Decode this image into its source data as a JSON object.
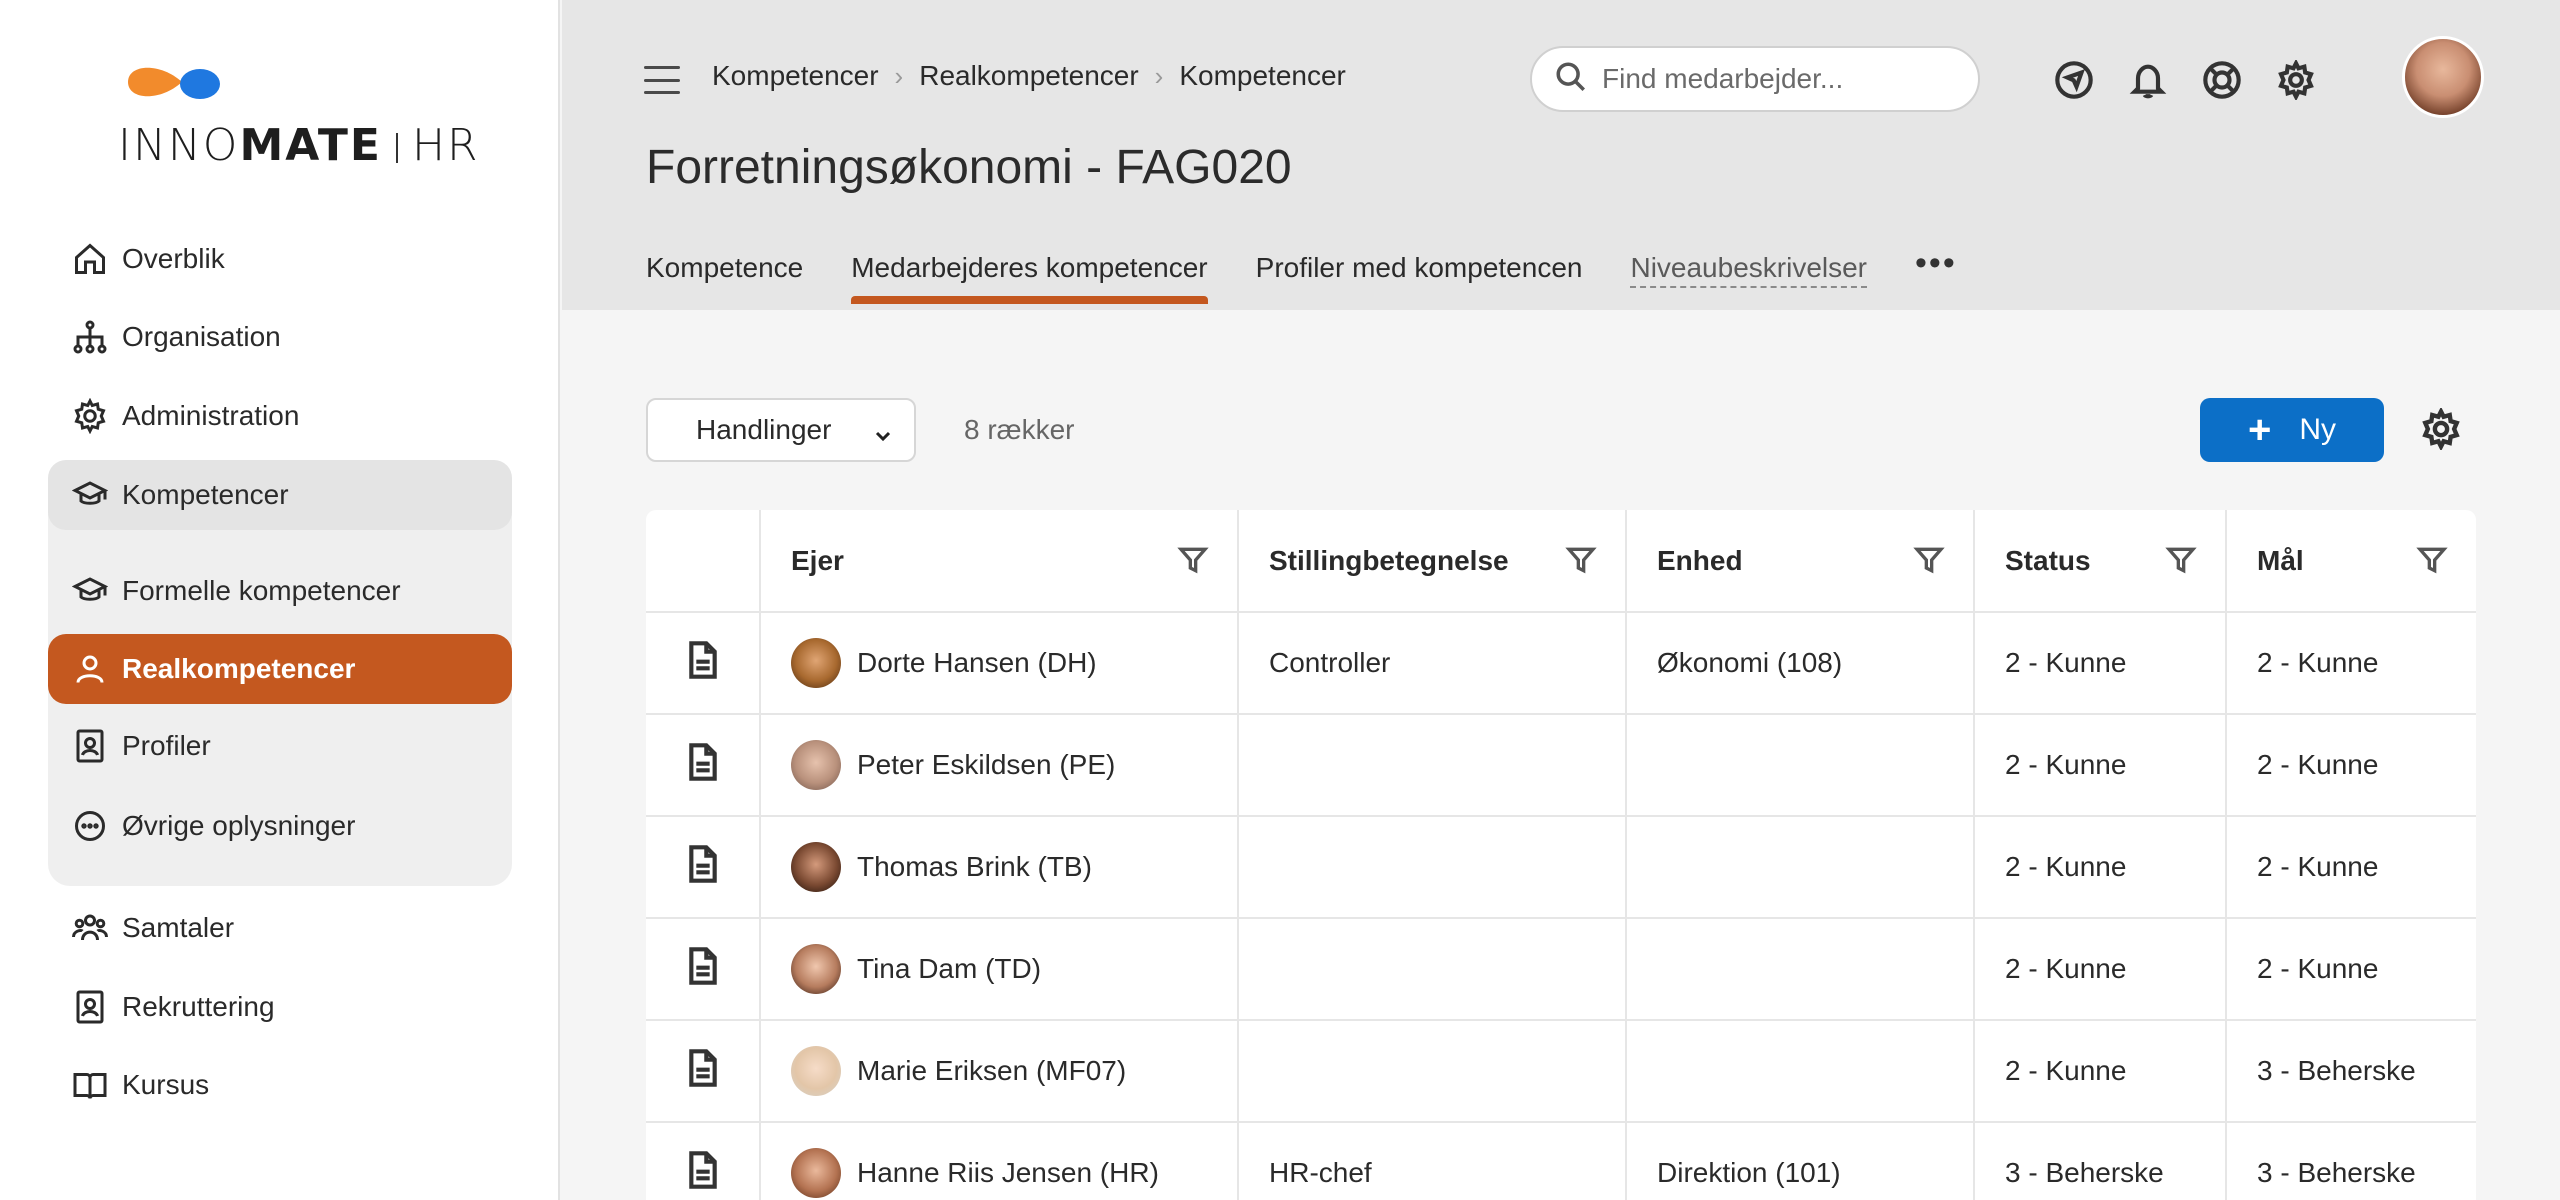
{
  "app": {
    "logo_left": "INNO",
    "logo_mid": "MATE",
    "logo_right": "HR"
  },
  "sidebar": {
    "items": [
      {
        "label": "Overblik",
        "icon": "home-icon"
      },
      {
        "label": "Organisation",
        "icon": "org-chart-icon"
      },
      {
        "label": "Administration",
        "icon": "gear-icon"
      },
      {
        "label": "Kompetencer",
        "icon": "graduation-cap-icon"
      },
      {
        "label": "Formelle kompetencer",
        "icon": "graduation-cap-icon"
      },
      {
        "label": "Realkompetencer",
        "icon": "person-icon"
      },
      {
        "label": "Profiler",
        "icon": "id-badge-icon"
      },
      {
        "label": "Øvrige oplysninger",
        "icon": "more-circle-icon"
      },
      {
        "label": "Samtaler",
        "icon": "people-icon"
      },
      {
        "label": "Rekruttering",
        "icon": "id-badge-icon"
      },
      {
        "label": "Kursus",
        "icon": "book-icon"
      }
    ]
  },
  "header": {
    "breadcrumb": [
      "Kompetencer",
      "Realkompetencer",
      "Kompetencer"
    ],
    "search_placeholder": "Find medarbejder...",
    "page_title": "Forretningsøkonomi - FAG020",
    "tabs": [
      "Kompetence",
      "Medarbejderes kompetencer",
      "Profiler med kompetencen",
      "Niveaubeskrivelser"
    ],
    "tab_more": "•••"
  },
  "toolbar": {
    "actions_label": "Handlinger",
    "row_count": "8 rækker",
    "new_label": "Ny"
  },
  "table": {
    "columns": [
      "Ejer",
      "Stillingbetegnelse",
      "Enhed",
      "Status",
      "Mål"
    ],
    "rows": [
      {
        "owner": "Dorte Hansen (DH)",
        "title": "Controller",
        "unit": "Økonomi (108)",
        "status": "2 - Kunne",
        "goal": "2 - Kunne"
      },
      {
        "owner": "Peter Eskildsen (PE)",
        "title": "",
        "unit": "",
        "status": "2 - Kunne",
        "goal": "2 - Kunne"
      },
      {
        "owner": "Thomas Brink (TB)",
        "title": "",
        "unit": "",
        "status": "2 - Kunne",
        "goal": "2 - Kunne"
      },
      {
        "owner": "Tina Dam (TD)",
        "title": "",
        "unit": "",
        "status": "2 - Kunne",
        "goal": "2 - Kunne"
      },
      {
        "owner": "Marie Eriksen (MF07)",
        "title": "",
        "unit": "",
        "status": "2 - Kunne",
        "goal": "3 - Beherske"
      },
      {
        "owner": "Hanne Riis Jensen (HR)",
        "title": "HR-chef",
        "unit": "Direktion (101)",
        "status": "3 - Beherske",
        "goal": "3 - Beherske"
      }
    ]
  },
  "colors": {
    "accent": "#c4581f",
    "primary_button": "#0c6fc7"
  }
}
